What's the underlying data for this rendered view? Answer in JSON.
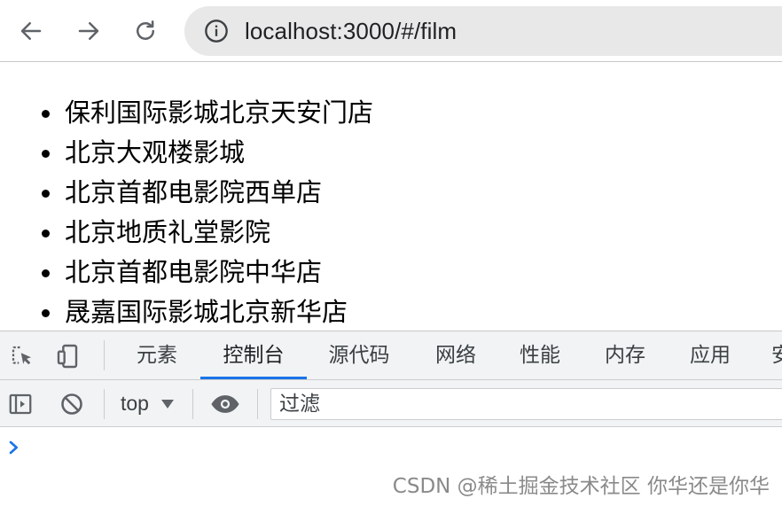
{
  "browser": {
    "url": "localhost:3000/#/film"
  },
  "film_list": [
    "保利国际影城北京天安门店",
    "北京大观楼影城",
    "北京首都电影院西单店",
    "北京地质礼堂影院",
    "北京首都电影院中华店",
    "晟嘉国际影城北京新华店"
  ],
  "devtools": {
    "tabs": [
      "元素",
      "控制台",
      "源代码",
      "网络",
      "性能",
      "内存",
      "应用",
      "安"
    ],
    "active_tab": "控制台",
    "context": "top",
    "filter_placeholder": "过滤"
  },
  "watermark": "CSDN @稀土掘金技术社区 你华还是你华"
}
